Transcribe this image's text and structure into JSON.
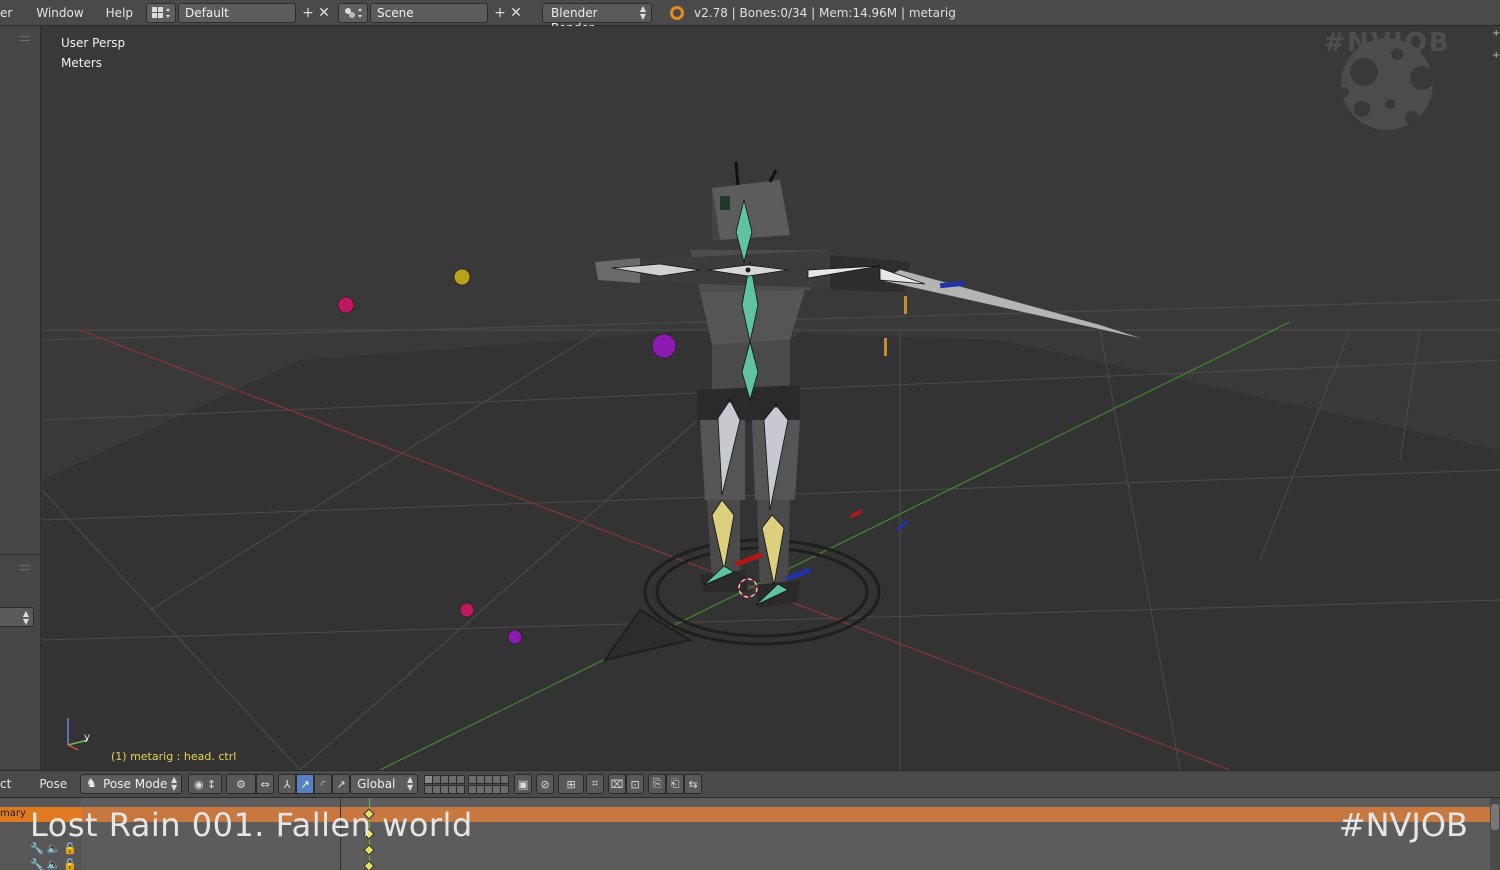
{
  "topbar": {
    "menus": [
      "er",
      "Window",
      "Help"
    ],
    "screen_layout": "Default",
    "scene": "Scene",
    "render_engine": "Blender Render",
    "info": "v2.78 | Bones:0/34 | Mem:14.96M | metarig"
  },
  "viewport": {
    "view_name": "User Persp",
    "units": "Meters",
    "status": "(1) metarig : head. ctrl",
    "watermark": "#NVJOB",
    "axis_y_label": "y"
  },
  "view3d_header": {
    "menus": [
      "ct",
      "Pose"
    ],
    "mode": "Pose Mode",
    "orientation": "Global"
  },
  "timeline": {
    "summary_label": "mary"
  },
  "overlay": {
    "title": "Lost Rain 001. Fallen world",
    "tag": "#NVJOB"
  },
  "colors": {
    "accent_blue": "#5680c2",
    "summary_orange": "#e07a22",
    "status_yellow": "#e8d25a"
  }
}
